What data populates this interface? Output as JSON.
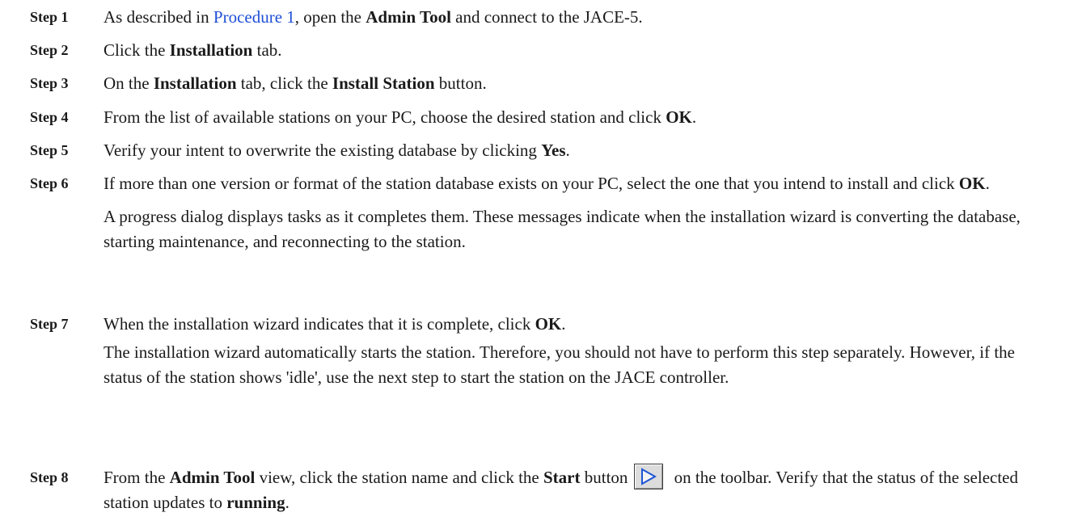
{
  "steps": [
    {
      "label": "Step 1",
      "pre": "As described in ",
      "link": "Procedure 1",
      "mid": ", open the ",
      "bold1": "Admin Tool",
      "post": " and connect to the JACE-5."
    },
    {
      "label": "Step 2",
      "pre": "Click the ",
      "bold1": "Installation",
      "post": " tab."
    },
    {
      "label": "Step 3",
      "pre": "On the ",
      "bold1": "Installation",
      "mid": " tab, click the ",
      "bold2": "Install Station",
      "post": " button."
    },
    {
      "label": "Step 4",
      "pre": "From the list of available stations on your PC, choose the desired station and click ",
      "bold1": "OK",
      "post": "."
    },
    {
      "label": "Step 5",
      "pre": "Verify your intent to overwrite the existing database by clicking ",
      "bold1": "Yes",
      "post": "."
    },
    {
      "label": "Step 6",
      "pre": "If more than one version or format of the station database exists on your PC, select the one that you intend to install and click ",
      "bold1": "OK",
      "post": ".",
      "note": "A progress dialog displays tasks as it completes them. These messages indicate when the installation wizard is converting the database, starting maintenance, and reconnecting to the station."
    },
    {
      "label": "Step 7",
      "pre": "When the installation wizard indicates that it is complete, click ",
      "bold1": "OK",
      "post": ".",
      "note": "The installation wizard automatically starts the station. Therefore, you should not have to perform this step separately. However, if the status of the station shows 'idle', use the next step to start the station on the JACE controller."
    },
    {
      "label": "Step 8",
      "pre": "From the ",
      "bold1": "Admin Tool",
      "mid": " view, click the station name and click the ",
      "bold2": "Start",
      "mid2": " button",
      "post": " on the toolbar. Verify that the status of the selected station updates to ",
      "bold3": "running",
      "end": ".",
      "icon": "play-start-icon"
    }
  ]
}
